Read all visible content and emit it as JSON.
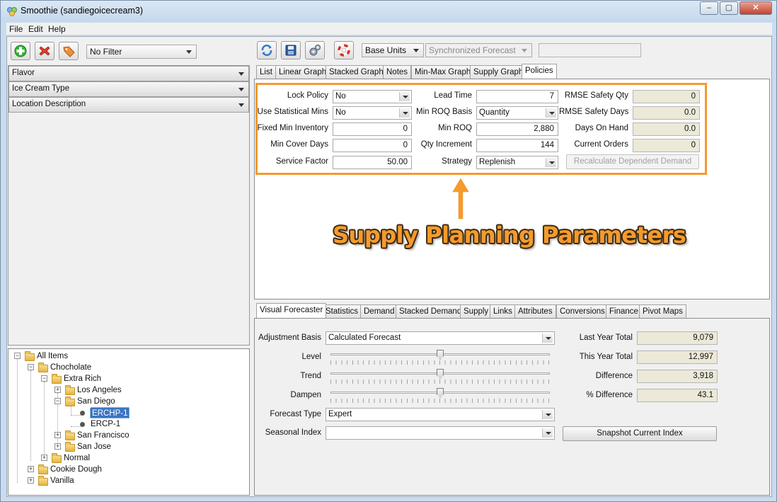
{
  "window": {
    "title": "Smoothie (sandiegoicecream3)",
    "controls": {
      "minimize": "–",
      "maximize": "▢",
      "close": "✕"
    }
  },
  "menu": [
    "File",
    "Edit",
    "Help"
  ],
  "left_toolbar": {
    "icons": [
      "add-icon",
      "delete-icon",
      "tag-icon"
    ],
    "filter_value": "No Filter"
  },
  "attribute_filters": [
    "Flavor",
    "Ice Cream Type",
    "Location Description"
  ],
  "tree": {
    "root": "All Items",
    "chocolate": "Chocholate",
    "extra_rich": "Extra Rich",
    "los_angeles": "Los Angeles",
    "san_diego": "San Diego",
    "erchp": "ERCHP-1",
    "ercp": "ERCP-1",
    "san_francisco": "San Francisco",
    "san_jose": "San Jose",
    "normal": "Normal",
    "cookie_dough": "Cookie Dough",
    "vanilla": "Vanilla",
    "selected": "ERCHP-1"
  },
  "main_toolbar": {
    "icons": [
      "refresh-icon",
      "save-icon",
      "settings-icon",
      "help-icon"
    ],
    "units": "Base Units",
    "forecast_mode": "Synchronized Forecast",
    "search_value": ""
  },
  "top_tabs": [
    "List",
    "Linear Graph",
    "Stacked Graph",
    "Notes",
    "Min-Max Graph",
    "Supply Graph",
    "Policies"
  ],
  "top_tabs_active": "Policies",
  "policies": {
    "lock_policy": {
      "label": "Lock Policy",
      "value": "No"
    },
    "use_statistical_mins": {
      "label": "Use Statistical Mins",
      "value": "No"
    },
    "fixed_min_inventory": {
      "label": "Fixed Min Inventory",
      "value": "0"
    },
    "min_cover_days": {
      "label": "Min Cover Days",
      "value": "0"
    },
    "service_factor": {
      "label": "Service Factor",
      "value": "50.00"
    },
    "lead_time": {
      "label": "Lead Time",
      "value": "7"
    },
    "min_roq_basis": {
      "label": "Min ROQ Basis",
      "value": "Quantity"
    },
    "min_roq": {
      "label": "Min ROQ",
      "value": "2,880"
    },
    "qty_increment": {
      "label": "Qty Increment",
      "value": "144"
    },
    "strategy": {
      "label": "Strategy",
      "value": "Replenish"
    },
    "rmse_safety_qty": {
      "label": "RMSE Safety Qty",
      "value": "0"
    },
    "rmse_safety_days": {
      "label": "RMSE Safety Days",
      "value": "0.0"
    },
    "days_on_hand": {
      "label": "Days On Hand",
      "value": "0.0"
    },
    "current_orders": {
      "label": "Current Orders",
      "value": "0"
    },
    "recalculate_button": "Recalculate Dependent Demand"
  },
  "annotation": {
    "text": "Supply Planning Parameters",
    "color": "#f59a2d"
  },
  "bottom_tabs": [
    "Visual Forecaster",
    "Statistics",
    "Demand",
    "Stacked Demand",
    "Supply",
    "Links",
    "Attributes",
    "Conversions",
    "Finance",
    "Pivot Maps"
  ],
  "bottom_tabs_active": "Visual Forecaster",
  "forecaster": {
    "adjustment_basis": {
      "label": "Adjustment Basis",
      "value": "Calculated Forecast"
    },
    "level": {
      "label": "Level",
      "position": 0.5
    },
    "trend": {
      "label": "Trend",
      "position": 0.5
    },
    "dampen": {
      "label": "Dampen",
      "position": 0.5
    },
    "forecast_type": {
      "label": "Forecast Type",
      "value": "Expert"
    },
    "seasonal_index": {
      "label": "Seasonal Index",
      "value": ""
    },
    "last_year_total": {
      "label": "Last Year Total",
      "value": "9,079"
    },
    "this_year_total": {
      "label": "This Year Total",
      "value": "12,997"
    },
    "difference": {
      "label": "Difference",
      "value": "3,918"
    },
    "pct_difference": {
      "label": "% Difference",
      "value": "43.1"
    },
    "snapshot_button": "Snapshot Current Index"
  }
}
